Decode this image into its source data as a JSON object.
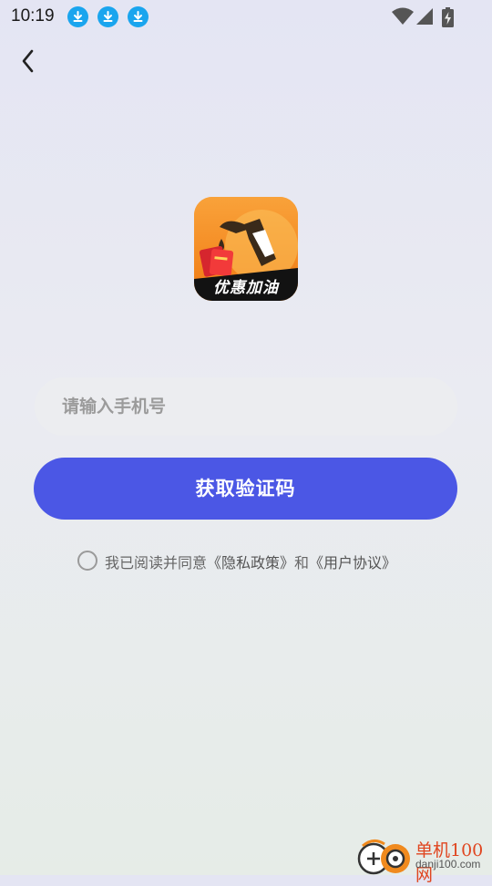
{
  "status_bar": {
    "time": "10:19",
    "notification_icons": [
      "download-icon",
      "download-icon",
      "download-icon"
    ],
    "system_icons": [
      "wifi-icon",
      "signal-icon",
      "battery-charging-icon"
    ]
  },
  "nav": {
    "back_icon": "chevron-left-icon"
  },
  "app": {
    "icon_text": "优惠加油",
    "icon_bg": "#f6901e"
  },
  "form": {
    "phone_placeholder": "请输入手机号",
    "phone_value": "",
    "get_code_label": "获取验证码",
    "button_color": "#4b57e5"
  },
  "agreement": {
    "checked": false,
    "prefix": "我已阅读并同意",
    "privacy_link": "《隐私政策》",
    "and": "和",
    "user_link": "《用户协议》"
  },
  "watermark": {
    "name": "单机100网",
    "url": "danji100.com"
  }
}
